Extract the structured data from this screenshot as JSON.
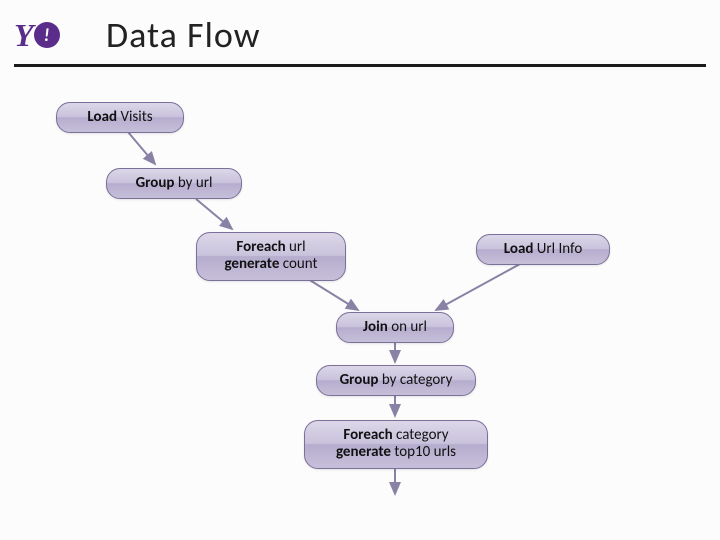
{
  "header": {
    "logo_text": "Y",
    "logo_exclaim": "!",
    "title": "Data  Flow"
  },
  "nodes": {
    "load_visits": {
      "kw1": "Load ",
      "arg1": "Visits"
    },
    "group_url": {
      "kw1": "Group ",
      "arg1": "by url"
    },
    "foreach_url": {
      "kw1": "Foreach ",
      "arg1": "url",
      "kw2": "generate ",
      "arg2": "count"
    },
    "load_urlinfo": {
      "kw1": "Load ",
      "arg1": "Url Info"
    },
    "join": {
      "kw1": "Join ",
      "arg1": "on url"
    },
    "group_cat": {
      "kw1": "Group ",
      "arg1": "by category"
    },
    "foreach_cat": {
      "kw1": "Foreach ",
      "arg1": "category",
      "kw2": "generate ",
      "arg2": "top10 urls"
    }
  }
}
